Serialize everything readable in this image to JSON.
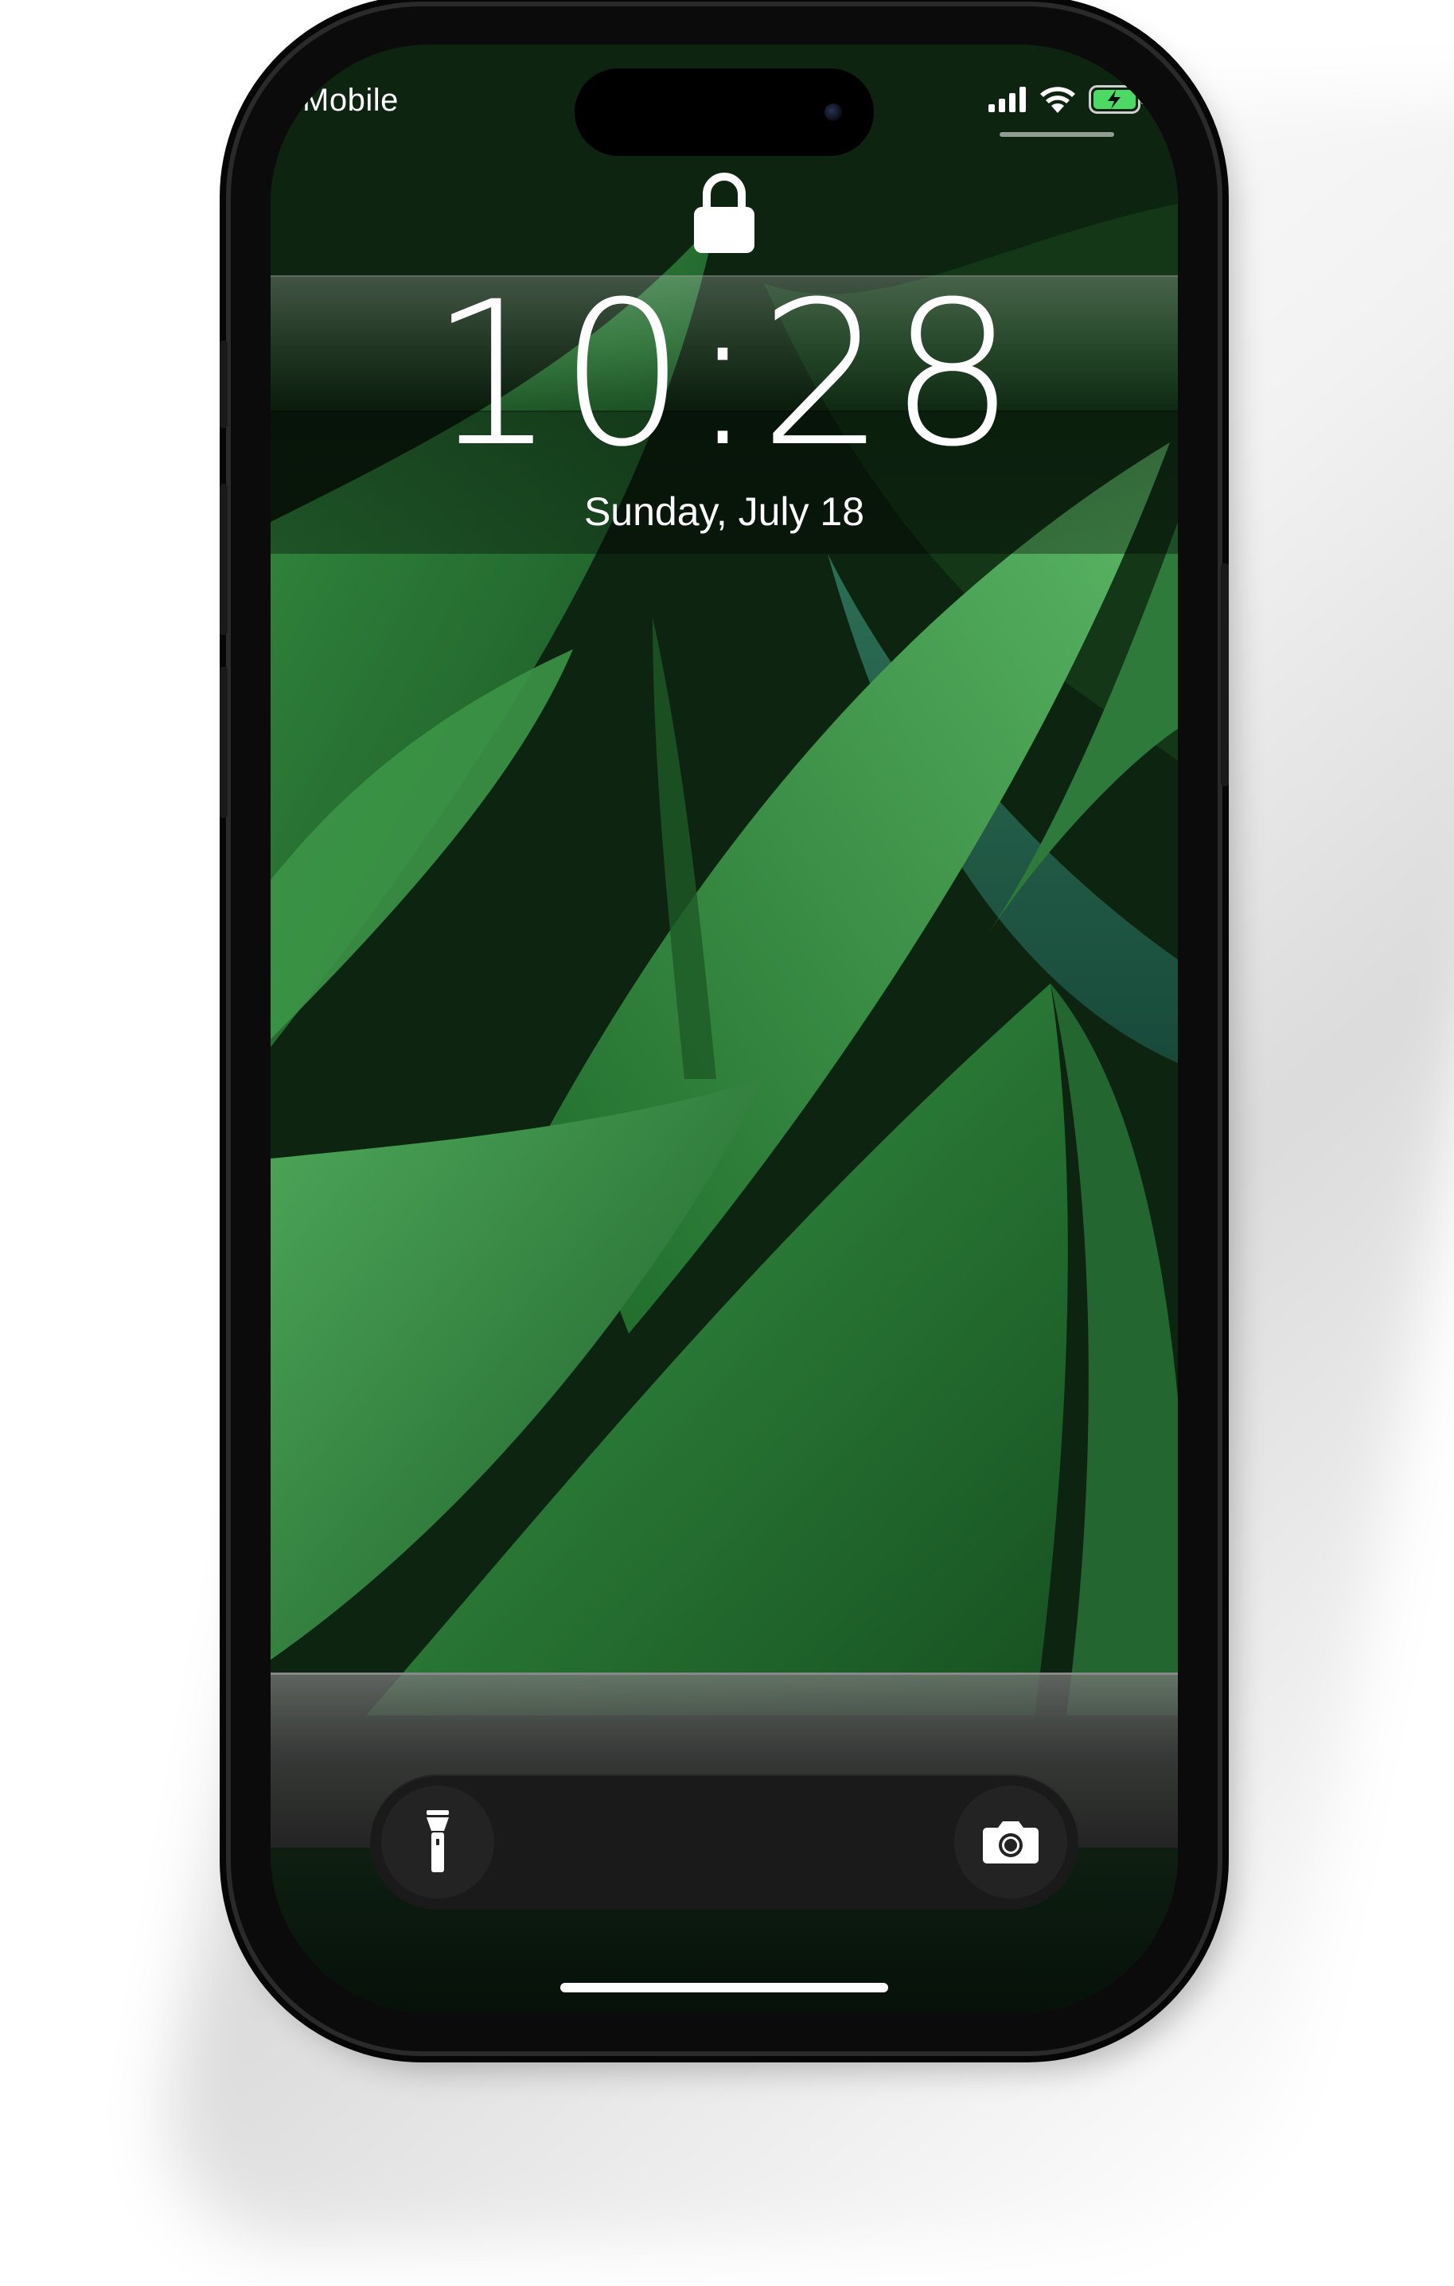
{
  "status_bar": {
    "carrier": "Mobile",
    "signal_bars": 4,
    "wifi": true,
    "battery_charging": true
  },
  "lock_screen": {
    "time": "10:28",
    "date": "Sunday, July 18"
  },
  "quick_actions": {
    "flashlight_icon": "flashlight-icon",
    "camera_icon": "camera-icon"
  },
  "colors": {
    "wallpaper_primary": "#2a7a36",
    "battery_charging": "#4cd964",
    "text": "#ffffff"
  }
}
